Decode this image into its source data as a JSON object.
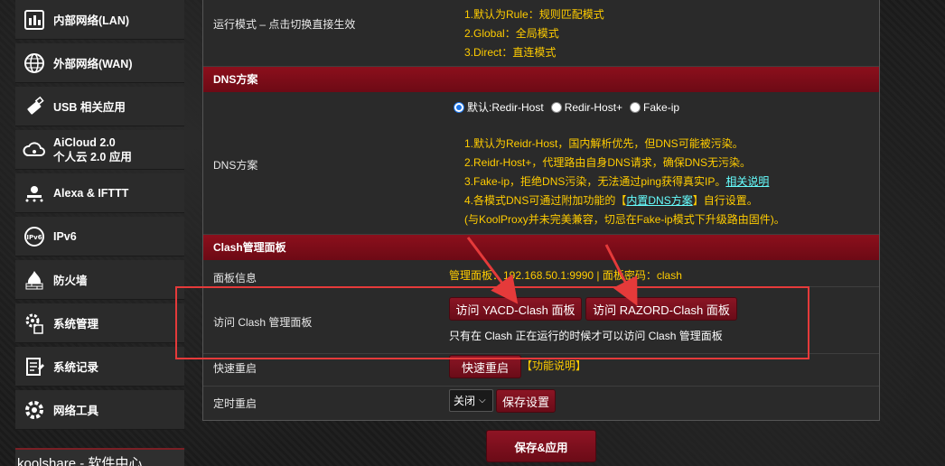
{
  "sidebar": {
    "items": [
      {
        "label": "内部网络(LAN)",
        "icon": "home-network-icon"
      },
      {
        "label": "外部网络(WAN)",
        "icon": "globe-icon"
      },
      {
        "label": "USB 相关应用",
        "icon": "usb-icon"
      },
      {
        "label_line1": "AiCloud 2.0",
        "label_line2": "个人云 2.0 应用",
        "icon": "cloud-icon"
      },
      {
        "label": "Alexa & IFTTT",
        "icon": "alexa-icon"
      },
      {
        "label": "IPv6",
        "icon": "ipv6-icon"
      },
      {
        "label": "防火墙",
        "icon": "firewall-icon"
      },
      {
        "label": "系统管理",
        "icon": "system-admin-icon"
      },
      {
        "label": "系统记录",
        "icon": "system-log-icon"
      },
      {
        "label": "网络工具",
        "icon": "network-tools-icon"
      }
    ],
    "softcenter": "koolshare - 软件中心"
  },
  "run_mode": {
    "label": "运行模式 – 点击切换直接生效",
    "notes": [
      "1.默认为Rule：规则匹配模式",
      "2.Global：全局模式",
      "3.Direct：直连模式"
    ]
  },
  "dns_section": {
    "header": "DNS方案",
    "label": "DNS方案",
    "options": [
      "默认:Redir-Host",
      "Redir-Host+",
      "Fake-ip"
    ],
    "selected": 0,
    "notes": [
      "1.默认为Reidr-Host，国内解析优先，但DNS可能被污染。",
      "2.Reidr-Host+，代理路由自身DNS请求，确保DNS无污染。",
      "3.Fake-ip，拒绝DNS污染，无法通过ping获得真实IP。"
    ],
    "note3_link": "相关说明",
    "note4_prefix": "4.各模式DNS可通过附加功能的【",
    "note4_link": "内置DNS方案",
    "note4_suffix": "】自行设置。",
    "note5": "(与KoolProxy并未完美兼容，切忌在Fake-ip模式下升级路由固件)。"
  },
  "clash_section": {
    "header": "Clash管理面板",
    "panel_info_label": "面板信息",
    "panel_info_value": "管理面板：192.168.50.1:9990 | 面板密码：clash",
    "access_label": "访问 Clash 管理面板",
    "yacd_button": "访问 YACD-Clash 面板",
    "razord_button": "访问 RAZORD-Clash 面板",
    "access_note": "只有在 Clash 正在运行的时候才可以访问 Clash 管理面板",
    "quick_restart_label": "快速重启",
    "quick_restart_button": "快速重启",
    "quick_restart_help": "【功能说明】",
    "timed_restart_label": "定时重启",
    "timed_restart_select": "关闭",
    "save_settings_button": "保存设置"
  },
  "footer": {
    "save_apply": "保存&应用"
  },
  "colors": {
    "accent": "#8c0f1c",
    "note_text": "#ffcc00",
    "link": "#66ffff",
    "annotation": "#e53a3a"
  }
}
